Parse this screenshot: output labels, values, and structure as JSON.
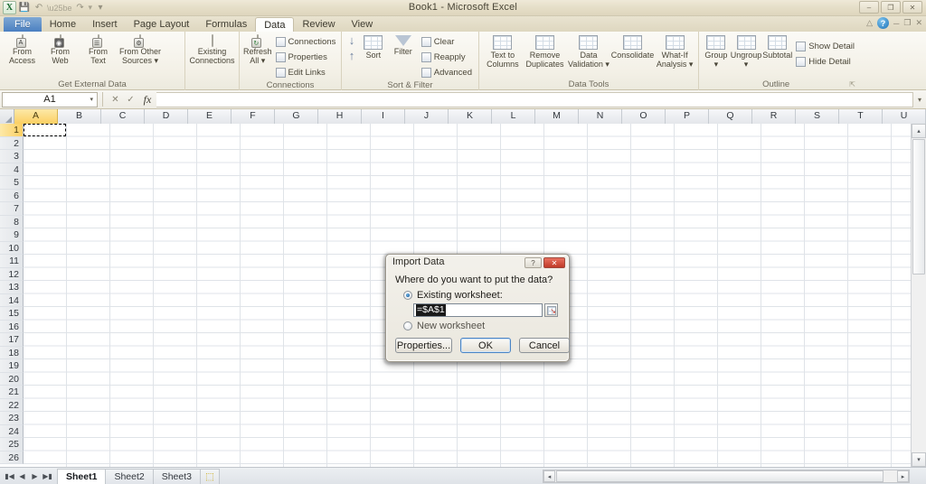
{
  "window": {
    "title": "Book1  -  Microsoft Excel",
    "logo": "excel-logo",
    "quick_access": [
      {
        "name": "save-icon",
        "glyph": "💾"
      },
      {
        "name": "undo-icon",
        "glyph": "↶"
      },
      {
        "name": "redo-icon",
        "glyph": "↷"
      },
      {
        "name": "customize-qat-icon",
        "glyph": "▾"
      }
    ],
    "controls": [
      {
        "name": "minimize-button",
        "glyph": "–"
      },
      {
        "name": "restore-button",
        "glyph": "❐"
      },
      {
        "name": "close-button",
        "glyph": "✕"
      }
    ]
  },
  "ribbon": {
    "tabs": [
      {
        "label": "File",
        "kind": "file"
      },
      {
        "label": "Home",
        "kind": "normal"
      },
      {
        "label": "Insert",
        "kind": "normal"
      },
      {
        "label": "Page Layout",
        "kind": "normal"
      },
      {
        "label": "Formulas",
        "kind": "normal"
      },
      {
        "label": "Data",
        "kind": "active"
      },
      {
        "label": "Review",
        "kind": "normal"
      },
      {
        "label": "View",
        "kind": "normal"
      }
    ],
    "minimize_ribbon_icon": "chevron-up-icon",
    "help_icon": "help-question-icon",
    "groups": [
      {
        "label": "Get External Data",
        "big_buttons": [
          {
            "label_line1": "From",
            "label_line2": "Access",
            "icon": "from-access-icon"
          },
          {
            "label_line1": "From",
            "label_line2": "Web",
            "icon": "from-web-icon"
          },
          {
            "label_line1": "From",
            "label_line2": "Text",
            "icon": "from-text-icon"
          },
          {
            "label_line1": "From Other",
            "label_line2": "Sources ▾",
            "icon": "from-other-sources-icon"
          }
        ]
      },
      {
        "label": "",
        "big_buttons": [
          {
            "label_line1": "Existing",
            "label_line2": "Connections",
            "icon": "existing-connections-icon"
          }
        ]
      },
      {
        "label": "Connections",
        "big_buttons": [
          {
            "label_line1": "Refresh",
            "label_line2": "All ▾",
            "icon": "refresh-all-icon"
          }
        ],
        "small_buttons": [
          {
            "label": "Connections",
            "icon": "connections-icon"
          },
          {
            "label": "Properties",
            "icon": "properties-icon"
          },
          {
            "label": "Edit Links",
            "icon": "edit-links-icon"
          }
        ]
      },
      {
        "label": "Sort & Filter",
        "sort_buttons": [
          {
            "label": "",
            "icon": "sort-ascending-icon"
          },
          {
            "label": "",
            "icon": "sort-descending-icon"
          }
        ],
        "big_buttons": [
          {
            "label_line1": "",
            "label_line2": "Sort",
            "icon": "sort-icon"
          },
          {
            "label_line1": "",
            "label_line2": "Filter",
            "icon": "filter-icon"
          }
        ],
        "small_buttons": [
          {
            "label": "Clear",
            "icon": "clear-filter-icon"
          },
          {
            "label": "Reapply",
            "icon": "reapply-filter-icon"
          },
          {
            "label": "Advanced",
            "icon": "advanced-filter-icon"
          }
        ]
      },
      {
        "label": "Data Tools",
        "big_buttons": [
          {
            "label_line1": "Text to",
            "label_line2": "Columns",
            "icon": "text-to-columns-icon"
          },
          {
            "label_line1": "Remove",
            "label_line2": "Duplicates",
            "icon": "remove-duplicates-icon"
          },
          {
            "label_line1": "Data",
            "label_line2": "Validation ▾",
            "icon": "data-validation-icon"
          },
          {
            "label_line1": "",
            "label_line2": "Consolidate",
            "icon": "consolidate-icon"
          },
          {
            "label_line1": "What-If",
            "label_line2": "Analysis ▾",
            "icon": "what-if-analysis-icon"
          }
        ]
      },
      {
        "label": "Outline",
        "dialog_launcher": "⬌",
        "big_buttons": [
          {
            "label_line1": "",
            "label_line2": "Group ▾",
            "icon": "group-icon"
          },
          {
            "label_line1": "",
            "label_line2": "Ungroup ▾",
            "icon": "ungroup-icon"
          },
          {
            "label_line1": "",
            "label_line2": "Subtotal",
            "icon": "subtotal-icon"
          }
        ],
        "small_buttons": [
          {
            "label": "Show Detail",
            "icon": "show-detail-icon"
          },
          {
            "label": "Hide Detail",
            "icon": "hide-detail-icon"
          }
        ]
      }
    ]
  },
  "formula_bar": {
    "name_box_value": "A1",
    "name_box_caret": "▾",
    "cancel_icon": "cancel-icon",
    "enter_icon": "enter-icon",
    "fx_label": "fx",
    "formula_value": "",
    "expand_icon": "▾"
  },
  "grid": {
    "columns": [
      "A",
      "B",
      "C",
      "D",
      "E",
      "F",
      "G",
      "H",
      "I",
      "J",
      "K",
      "L",
      "M",
      "N",
      "O",
      "P",
      "Q",
      "R",
      "S",
      "T",
      "U"
    ],
    "selected_column": "A",
    "rows": [
      1,
      2,
      3,
      4,
      5,
      6,
      7,
      8,
      9,
      10,
      11,
      12,
      13,
      14,
      15,
      16,
      17,
      18,
      19,
      20,
      21,
      22,
      23,
      24,
      25,
      26
    ],
    "selected_row": 1,
    "active_cell": "A1",
    "active_cell_value": "",
    "scroll_up_icon": "▴",
    "scroll_down_icon": "▾",
    "scroll_left_icon": "◂",
    "scroll_right_icon": "▸"
  },
  "sheet_bar": {
    "nav_buttons": [
      {
        "name": "first-sheet-button",
        "glyph": "⏮"
      },
      {
        "name": "prev-sheet-button",
        "glyph": "◀"
      },
      {
        "name": "next-sheet-button",
        "glyph": "▶"
      },
      {
        "name": "last-sheet-button",
        "glyph": "⏭"
      }
    ],
    "tabs": [
      {
        "label": "Sheet1",
        "active": true
      },
      {
        "label": "Sheet2",
        "active": false
      },
      {
        "label": "Sheet3",
        "active": false
      }
    ],
    "insert_sheet_label": "⬚",
    "insert_sheet_name": "insert-worksheet-icon"
  },
  "dialog": {
    "title": "Import Data",
    "help_glyph": "?",
    "close_glyph": "✕",
    "question": "Where do you want to put the data?",
    "options": [
      {
        "label": "Existing worksheet:",
        "selected": true,
        "name": "existing-worksheet-radio"
      },
      {
        "label": "New worksheet",
        "selected": false,
        "name": "new-worksheet-radio"
      }
    ],
    "reference_value": "=$A$1",
    "reference_selected": true,
    "range_picker_icon": "range-selector-icon",
    "buttons": [
      {
        "label": "Properties...",
        "name": "properties-button",
        "default": false
      },
      {
        "label": "OK",
        "name": "ok-button",
        "default": true
      },
      {
        "label": "Cancel",
        "name": "cancel-button",
        "default": false
      }
    ]
  },
  "colors": {
    "accent": "#4a7fc1",
    "selection_header": "#fbcf63",
    "dialog_close": "#c03a28",
    "default_button_border": "#4a84c4"
  }
}
